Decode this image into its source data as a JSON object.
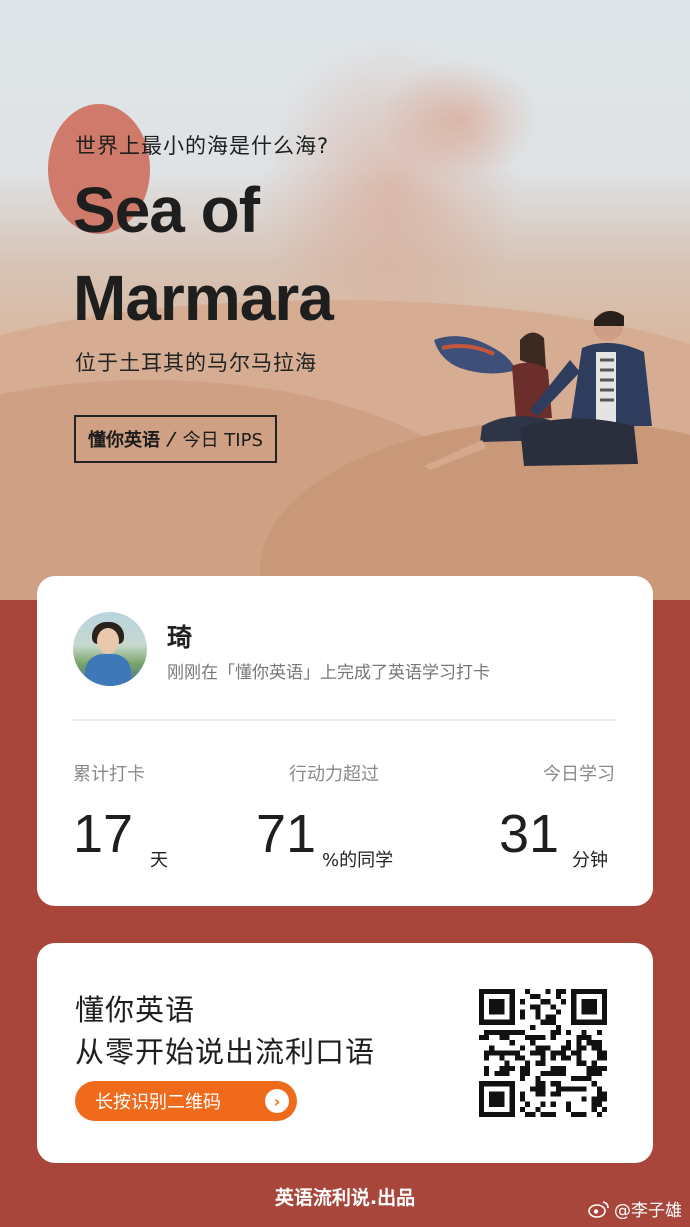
{
  "hero": {
    "question": "世界上最小的海是什么海?",
    "title": "Sea of Marmara",
    "subtitle": "位于土耳其的马尔马拉海",
    "tag_brand": "懂你英语",
    "tag_slash": "/",
    "tag_tips": "今日 TIPS"
  },
  "profile": {
    "name": "琦",
    "description": "刚刚在「懂你英语」上完成了英语学习打卡"
  },
  "stats": [
    {
      "label": "累计打卡",
      "value": "17",
      "unit": "天"
    },
    {
      "label": "行动力超过",
      "value": "71",
      "unit": "%的同学"
    },
    {
      "label": "今日学习",
      "value": "31",
      "unit": "分钟"
    }
  ],
  "promo": {
    "line1": "懂你英语",
    "line2": "从零开始说出流利口语",
    "cta_label": "长按识别二维码",
    "cta_arrow": "›"
  },
  "footer": {
    "brand": "英语流利说.出品",
    "watermark": "@李子雄"
  },
  "colors": {
    "background": "#a9463b",
    "accent_orange": "#f06a1c",
    "deco_circle": "#cf7a6b"
  }
}
